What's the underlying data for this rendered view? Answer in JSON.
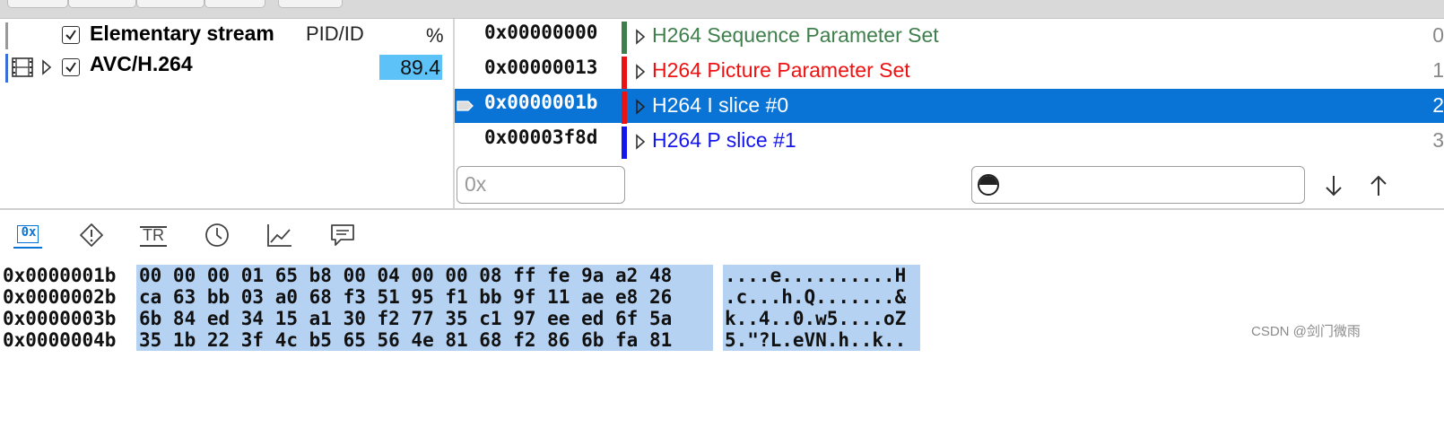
{
  "streams": {
    "header": {
      "title": "Elementary stream",
      "pid_label": "PID/ID",
      "percent_label": "%"
    },
    "rows": [
      {
        "name": "AVC/H.264",
        "percent": "89.4"
      }
    ]
  },
  "units": [
    {
      "offset": "0x00000000",
      "label": "H264 Sequence Parameter Set",
      "index": "0",
      "color": "#3f7f4c"
    },
    {
      "offset": "0x00000013",
      "label": "H264 Picture Parameter Set",
      "index": "1",
      "color": "#ee1111"
    },
    {
      "offset": "0x0000001b",
      "label": "H264 I slice #0",
      "index": "2",
      "color": "#ffffff",
      "selected": true
    },
    {
      "offset": "0x00003f8d",
      "label": "H264 P slice #1",
      "index": "3",
      "color": "#1515ee"
    }
  ],
  "bars": [
    "#3f7f4c",
    "#ee1111",
    "#ee1111",
    "#1515ee"
  ],
  "offset_input": {
    "placeholder": "0x"
  },
  "search_input": {
    "placeholder": ""
  },
  "tabs": [
    "hex-tab",
    "warning-tab",
    "transport-tab",
    "timing-tab",
    "graph-tab",
    "comment-tab"
  ],
  "tab_hex_label": "0x",
  "tab_tr_label": "TR",
  "hex": [
    {
      "addr": "0x0000001b",
      "bytes": "00 00 00 01 65 b8 00 04 00 00 08 ff fe 9a a2 48",
      "ascii": "....e..........H"
    },
    {
      "addr": "0x0000002b",
      "bytes": "ca 63 bb 03 a0 68 f3 51 95 f1 bb 9f 11 ae e8 26",
      "ascii": ".c...h.Q.......&"
    },
    {
      "addr": "0x0000003b",
      "bytes": "6b 84 ed 34 15 a1 30 f2 77 35 c1 97 ee ed 6f 5a",
      "ascii": "k..4..0.w5....oZ"
    },
    {
      "addr": "0x0000004b",
      "bytes": "35 1b 22 3f 4c b5 65 56 4e 81 68 f2 86 6b fa 81",
      "ascii": "5.\"?L.eVN.h..k.."
    }
  ],
  "watermark": "CSDN @剑门微雨"
}
